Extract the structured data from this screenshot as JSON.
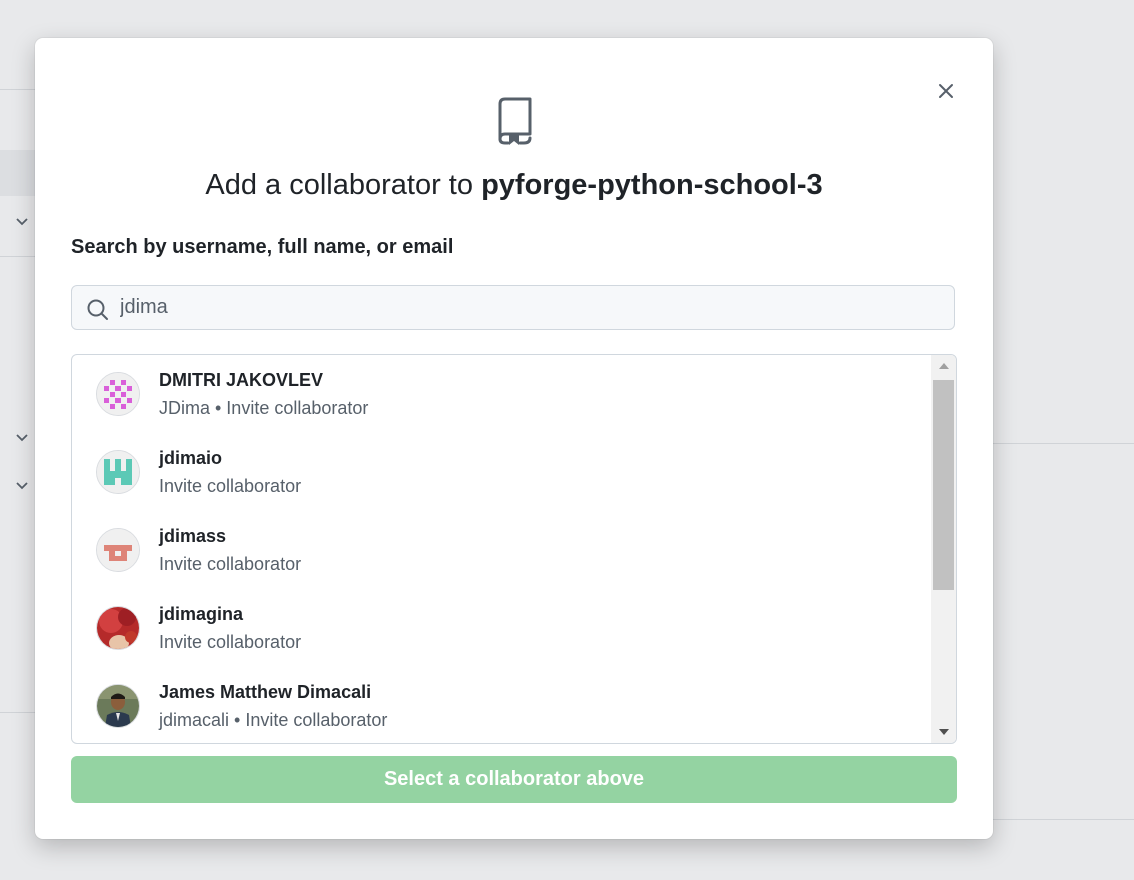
{
  "dialog": {
    "title_prefix": "Add a collaborator to",
    "repo_name": "pyforge-python-school-3",
    "search_label": "Search by username, full name, or email",
    "search_value": "jdima",
    "submit_label": "Select a collaborator above",
    "submit_color": "#94d3a2"
  },
  "results": [
    {
      "name": "DMITRI JAKOVLEV",
      "sub": "JDima • Invite collaborator",
      "avatar": "identicon-magenta"
    },
    {
      "name": "jdimaio",
      "sub": "Invite collaborator",
      "avatar": "identicon-teal"
    },
    {
      "name": "jdimass",
      "sub": "Invite collaborator",
      "avatar": "identicon-salmon"
    },
    {
      "name": "jdimagina",
      "sub": "Invite collaborator",
      "avatar": "photo-red"
    },
    {
      "name": "James Matthew Dimacali",
      "sub": "jdimacali • Invite collaborator",
      "avatar": "photo-person"
    }
  ]
}
